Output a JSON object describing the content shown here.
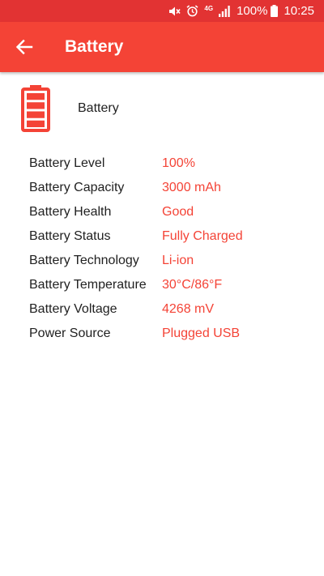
{
  "status_bar": {
    "network_label": "4G",
    "battery_percent": "100%",
    "time": "10:25"
  },
  "app_bar": {
    "title": "Battery"
  },
  "battery_header": {
    "label": "Battery",
    "level_fraction": 1.0,
    "segments": 4
  },
  "info": [
    {
      "label": "Battery Level",
      "value": "100%"
    },
    {
      "label": "Battery Capacity",
      "value": "3000 mAh"
    },
    {
      "label": "Battery Health",
      "value": "Good"
    },
    {
      "label": "Battery Status",
      "value": "Fully Charged"
    },
    {
      "label": "Battery Technology",
      "value": "Li-ion"
    },
    {
      "label": "Battery Temperature",
      "value": "30°C/86°F"
    },
    {
      "label": "Battery Voltage",
      "value": "4268 mV"
    },
    {
      "label": "Power Source",
      "value": "Plugged USB"
    }
  ],
  "colors": {
    "status_bar": "#e23333",
    "app_bar": "#f44336",
    "accent": "#f44336",
    "label_text": "#212121"
  },
  "icons": [
    "mute-icon",
    "alarm-icon",
    "signal-icon",
    "battery-icon",
    "back-arrow-icon"
  ]
}
